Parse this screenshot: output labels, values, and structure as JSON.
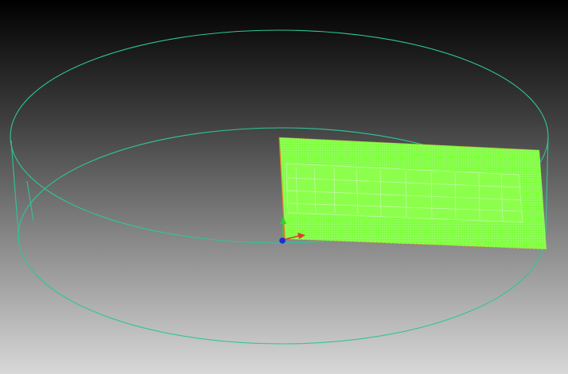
{
  "viewport": {
    "background_top": "#000000",
    "background_bottom": "#d8d8d8"
  },
  "scene": {
    "objects": [
      {
        "name": "cylinder-wireframe",
        "color": "#2fc59a",
        "style": "wireframe"
      },
      {
        "name": "mesh-plane",
        "fill": "#7dff3c",
        "mesh_line_color": "#c9f7b0",
        "edge_color": "#e87a2a",
        "style": "structured-mesh"
      }
    ],
    "triad": {
      "x_axis_color": "#e03a2a",
      "y_axis_color": "#2fd12f",
      "z_axis_color": "#1e2bd6"
    }
  }
}
